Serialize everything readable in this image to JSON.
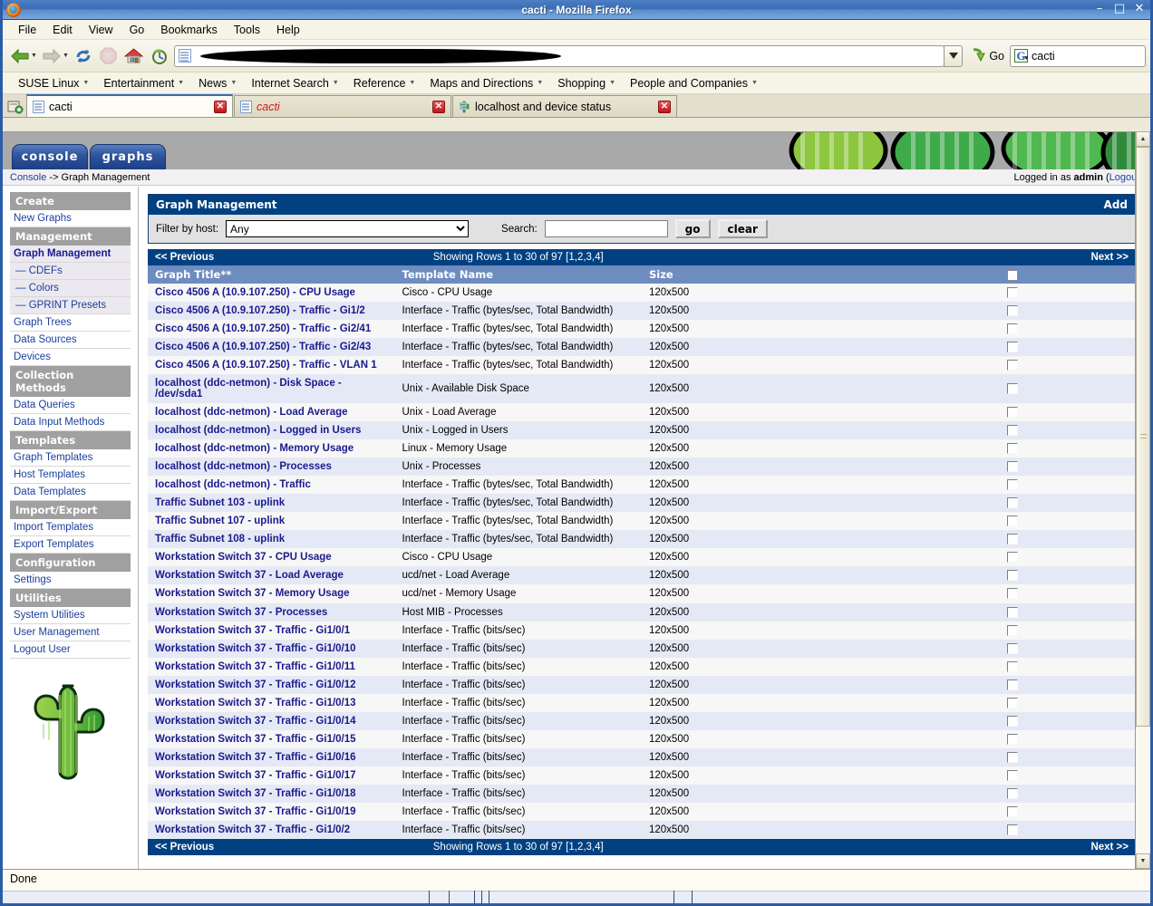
{
  "window": {
    "title": "cacti - Mozilla Firefox",
    "minimize": "–",
    "maximize": "□",
    "close": "✕"
  },
  "menubar": [
    {
      "label": "File"
    },
    {
      "label": "Edit"
    },
    {
      "label": "View"
    },
    {
      "label": "Go"
    },
    {
      "label": "Bookmarks"
    },
    {
      "label": "Tools"
    },
    {
      "label": "Help"
    }
  ],
  "toolbar": {
    "back_icon": "back-arrow-icon",
    "forward_icon": "forward-arrow-icon",
    "reload_icon": "reload-icon",
    "stop_icon": "stop-icon",
    "home_icon": "home-icon",
    "history_icon": "history-icon",
    "url_value": "",
    "url_placeholder": "",
    "go_label": "Go",
    "search_value": "cacti",
    "search_engine_letter": "G"
  },
  "bookmarks": [
    {
      "label": "SUSE Linux"
    },
    {
      "label": "Entertainment"
    },
    {
      "label": "News"
    },
    {
      "label": "Internet Search"
    },
    {
      "label": "Reference"
    },
    {
      "label": "Maps and Directions"
    },
    {
      "label": "Shopping"
    },
    {
      "label": "People and Companies"
    }
  ],
  "tabs": [
    {
      "label": "cacti",
      "active": true,
      "loading": false,
      "favicon": "page-icon",
      "close": "✕"
    },
    {
      "label": "cacti",
      "active": false,
      "loading": true,
      "favicon": "page-icon",
      "close": "✕"
    },
    {
      "label": "localhost and device status",
      "active": false,
      "loading": false,
      "favicon": "cactus-icon",
      "close": "✕"
    }
  ],
  "cacti": {
    "tabs": [
      {
        "label": "console"
      },
      {
        "label": "graphs"
      }
    ],
    "breadcrumb_link": "Console",
    "breadcrumb_rest": " -> Graph Management",
    "login_prefix": "Logged in as ",
    "login_user": "admin",
    "logout_open": " (",
    "logout_label": "Logout",
    "logout_close": ")",
    "panel_title": "Graph Management",
    "add_label": "Add",
    "filter_label": "Filter by host:",
    "filter_value": "Any",
    "search_label": "Search:",
    "search_value": "",
    "go_label": "go",
    "clear_label": "clear",
    "pagination": {
      "previous": "<< Previous",
      "showing": "Showing Rows 1 to 30 of 97 [1,2,3,4]",
      "next": "Next >>"
    },
    "columns": {
      "title": "Graph Title**",
      "template": "Template Name",
      "size": "Size"
    },
    "rows": [
      {
        "title": "Cisco 4506 A (10.9.107.250) - CPU Usage",
        "template": "Cisco - CPU Usage",
        "size": "120x500"
      },
      {
        "title": "Cisco 4506 A (10.9.107.250) - Traffic - Gi1/2",
        "template": "Interface - Traffic (bytes/sec, Total Bandwidth)",
        "size": "120x500"
      },
      {
        "title": "Cisco 4506 A (10.9.107.250) - Traffic - Gi2/41",
        "template": "Interface - Traffic (bytes/sec, Total Bandwidth)",
        "size": "120x500"
      },
      {
        "title": "Cisco 4506 A (10.9.107.250) - Traffic - Gi2/43",
        "template": "Interface - Traffic (bytes/sec, Total Bandwidth)",
        "size": "120x500"
      },
      {
        "title": "Cisco 4506 A (10.9.107.250) - Traffic - VLAN 1",
        "template": "Interface - Traffic (bytes/sec, Total Bandwidth)",
        "size": "120x500"
      },
      {
        "title": "localhost (ddc-netmon) - Disk Space - /dev/sda1",
        "template": "Unix - Available Disk Space",
        "size": "120x500"
      },
      {
        "title": "localhost (ddc-netmon) - Load Average",
        "template": "Unix - Load Average",
        "size": "120x500"
      },
      {
        "title": "localhost (ddc-netmon) - Logged in Users",
        "template": "Unix - Logged in Users",
        "size": "120x500"
      },
      {
        "title": "localhost (ddc-netmon) - Memory Usage",
        "template": "Linux - Memory Usage",
        "size": "120x500"
      },
      {
        "title": "localhost (ddc-netmon) - Processes",
        "template": "Unix - Processes",
        "size": "120x500"
      },
      {
        "title": "localhost (ddc-netmon) - Traffic",
        "template": "Interface - Traffic (bytes/sec, Total Bandwidth)",
        "size": "120x500"
      },
      {
        "title": "Traffic Subnet 103 - uplink",
        "template": "Interface - Traffic (bytes/sec, Total Bandwidth)",
        "size": "120x500"
      },
      {
        "title": "Traffic Subnet 107 - uplink",
        "template": "Interface - Traffic (bytes/sec, Total Bandwidth)",
        "size": "120x500"
      },
      {
        "title": "Traffic Subnet 108 - uplink",
        "template": "Interface - Traffic (bytes/sec, Total Bandwidth)",
        "size": "120x500"
      },
      {
        "title": "Workstation Switch 37 - CPU Usage",
        "template": "Cisco - CPU Usage",
        "size": "120x500"
      },
      {
        "title": "Workstation Switch 37 - Load Average",
        "template": "ucd/net - Load Average",
        "size": "120x500"
      },
      {
        "title": "Workstation Switch 37 - Memory Usage",
        "template": "ucd/net - Memory Usage",
        "size": "120x500"
      },
      {
        "title": "Workstation Switch 37 - Processes",
        "template": "Host MIB - Processes",
        "size": "120x500"
      },
      {
        "title": "Workstation Switch 37 - Traffic - Gi1/0/1",
        "template": "Interface - Traffic (bits/sec)",
        "size": "120x500"
      },
      {
        "title": "Workstation Switch 37 - Traffic - Gi1/0/10",
        "template": "Interface - Traffic (bits/sec)",
        "size": "120x500"
      },
      {
        "title": "Workstation Switch 37 - Traffic - Gi1/0/11",
        "template": "Interface - Traffic (bits/sec)",
        "size": "120x500"
      },
      {
        "title": "Workstation Switch 37 - Traffic - Gi1/0/12",
        "template": "Interface - Traffic (bits/sec)",
        "size": "120x500"
      },
      {
        "title": "Workstation Switch 37 - Traffic - Gi1/0/13",
        "template": "Interface - Traffic (bits/sec)",
        "size": "120x500"
      },
      {
        "title": "Workstation Switch 37 - Traffic - Gi1/0/14",
        "template": "Interface - Traffic (bits/sec)",
        "size": "120x500"
      },
      {
        "title": "Workstation Switch 37 - Traffic - Gi1/0/15",
        "template": "Interface - Traffic (bits/sec)",
        "size": "120x500"
      },
      {
        "title": "Workstation Switch 37 - Traffic - Gi1/0/16",
        "template": "Interface - Traffic (bits/sec)",
        "size": "120x500"
      },
      {
        "title": "Workstation Switch 37 - Traffic - Gi1/0/17",
        "template": "Interface - Traffic (bits/sec)",
        "size": "120x500"
      },
      {
        "title": "Workstation Switch 37 - Traffic - Gi1/0/18",
        "template": "Interface - Traffic (bits/sec)",
        "size": "120x500"
      },
      {
        "title": "Workstation Switch 37 - Traffic - Gi1/0/19",
        "template": "Interface - Traffic (bits/sec)",
        "size": "120x500"
      },
      {
        "title": "Workstation Switch 37 - Traffic - Gi1/0/2",
        "template": "Interface - Traffic (bits/sec)",
        "size": "120x500"
      }
    ],
    "sidebar": [
      {
        "type": "head",
        "label": "Create"
      },
      {
        "type": "link",
        "label": "New Graphs"
      },
      {
        "type": "head",
        "label": "Management"
      },
      {
        "type": "link",
        "label": "Graph Management",
        "selected": true
      },
      {
        "type": "sub",
        "label": "— CDEFs"
      },
      {
        "type": "sub",
        "label": "— Colors"
      },
      {
        "type": "sub",
        "label": "— GPRINT Presets"
      },
      {
        "type": "link",
        "label": "Graph Trees"
      },
      {
        "type": "link",
        "label": "Data Sources"
      },
      {
        "type": "link",
        "label": "Devices"
      },
      {
        "type": "head",
        "label": "Collection Methods"
      },
      {
        "type": "link",
        "label": "Data Queries"
      },
      {
        "type": "link",
        "label": "Data Input Methods"
      },
      {
        "type": "head",
        "label": "Templates"
      },
      {
        "type": "link",
        "label": "Graph Templates"
      },
      {
        "type": "link",
        "label": "Host Templates"
      },
      {
        "type": "link",
        "label": "Data Templates"
      },
      {
        "type": "head",
        "label": "Import/Export"
      },
      {
        "type": "link",
        "label": "Import Templates"
      },
      {
        "type": "link",
        "label": "Export Templates"
      },
      {
        "type": "head",
        "label": "Configuration"
      },
      {
        "type": "link",
        "label": "Settings"
      },
      {
        "type": "head",
        "label": "Utilities"
      },
      {
        "type": "link",
        "label": "System Utilities"
      },
      {
        "type": "link",
        "label": "User Management"
      },
      {
        "type": "link",
        "label": "Logout User"
      }
    ]
  },
  "statusbar": {
    "text": "Done"
  },
  "colors": {
    "cacti_blue": "#014182",
    "header_blue": "#6d8cc0",
    "row_even": "#e5e9f5",
    "row_odd": "#f7f7f7",
    "link_blue": "#1a1a8d",
    "sidebar_head": "#a0a0a0",
    "titlebar_blue": "#3b6cb4"
  }
}
